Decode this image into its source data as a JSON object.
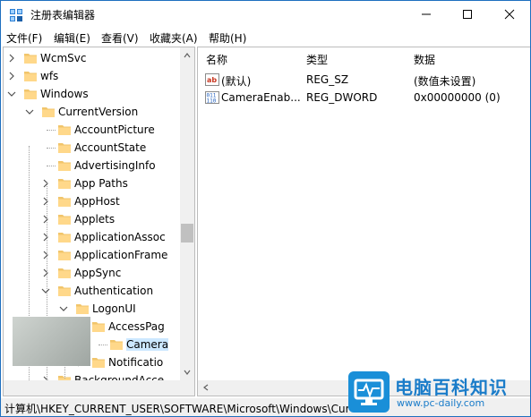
{
  "window": {
    "title": "注册表编辑器",
    "accent_color": "#1e6fbf"
  },
  "menubar": {
    "items": [
      {
        "label": "文件(F)"
      },
      {
        "label": "编辑(E)"
      },
      {
        "label": "查看(V)"
      },
      {
        "label": "收藏夹(A)"
      },
      {
        "label": "帮助(H)"
      }
    ]
  },
  "tree": {
    "items": [
      {
        "label": "WcmSvc",
        "expander": "collapsed"
      },
      {
        "label": "wfs",
        "expander": "collapsed"
      },
      {
        "label": "Windows",
        "expander": "expanded"
      },
      {
        "label": "CurrentVersion",
        "expander": "expanded"
      },
      {
        "label": "AccountPicture",
        "expander": "none"
      },
      {
        "label": "AccountState",
        "expander": "none"
      },
      {
        "label": "AdvertisingInfo",
        "expander": "none"
      },
      {
        "label": "App Paths",
        "expander": "collapsed"
      },
      {
        "label": "AppHost",
        "expander": "collapsed"
      },
      {
        "label": "Applets",
        "expander": "collapsed"
      },
      {
        "label": "ApplicationAssoc",
        "expander": "collapsed"
      },
      {
        "label": "ApplicationFrame",
        "expander": "collapsed"
      },
      {
        "label": "AppSync",
        "expander": "collapsed"
      },
      {
        "label": "Authentication",
        "expander": "expanded"
      },
      {
        "label": "LogonUI",
        "expander": "expanded"
      },
      {
        "label": "AccessPag",
        "expander": "expanded"
      },
      {
        "label": "Camera",
        "expander": "none",
        "selected": true
      },
      {
        "label": "Notificatio",
        "expander": "collapsed"
      },
      {
        "label": "BackgroundAcce",
        "expander": "collapsed"
      }
    ]
  },
  "list": {
    "headers": {
      "name": "名称",
      "type": "类型",
      "data": "数据"
    },
    "rows": [
      {
        "name": "(默认)",
        "type": "REG_SZ",
        "data": "(数值未设置)",
        "icon": "string-value-icon"
      },
      {
        "name": "CameraEnab...",
        "type": "REG_DWORD",
        "data": "0x00000000 (0)",
        "icon": "binary-value-icon"
      }
    ]
  },
  "statusbar": {
    "path": "计算机\\HKEY_CURRENT_USER\\SOFTWARE\\Microsoft\\Windows\\Cur"
  },
  "watermark": {
    "title": "电脑百科知识",
    "url": "www.pc-daily.com",
    "color": "#1a7cc9"
  }
}
